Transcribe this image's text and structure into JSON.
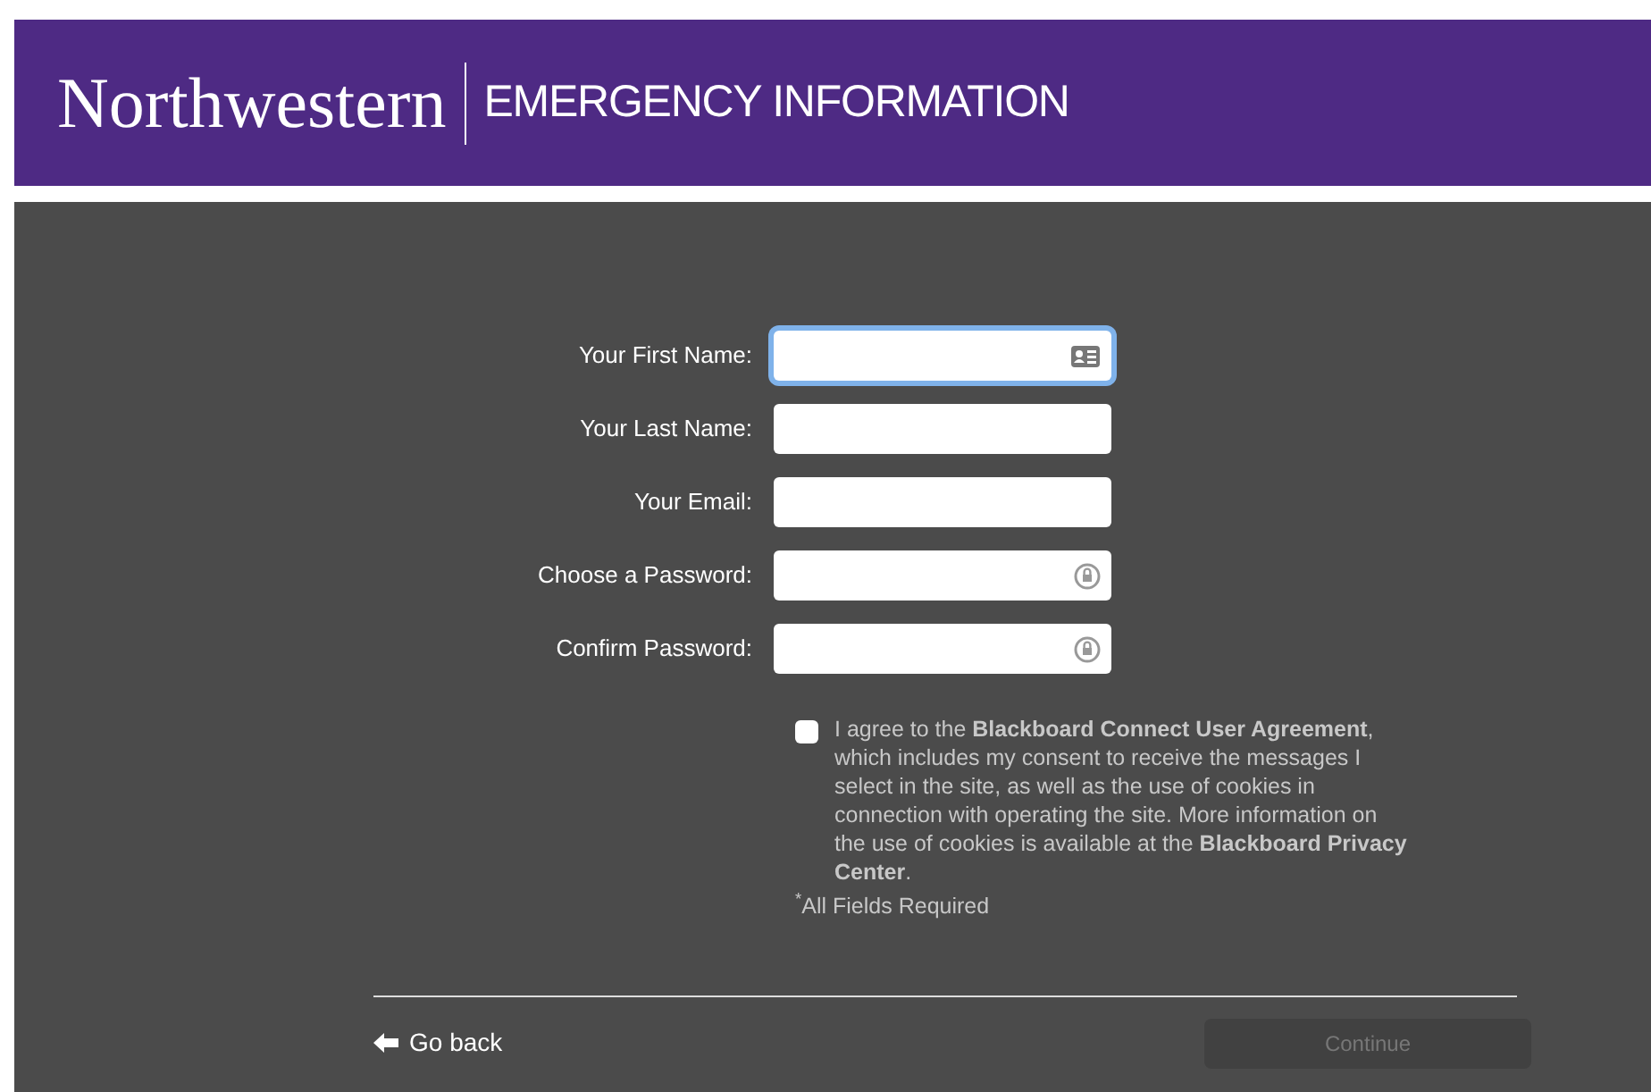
{
  "header": {
    "logo": "Northwestern",
    "title": "EMERGENCY INFORMATION"
  },
  "fields": [
    {
      "label": "Your First Name:",
      "focused": true,
      "kind": "contact"
    },
    {
      "label": "Your Last Name:",
      "focused": false,
      "kind": "text"
    },
    {
      "label": "Your Email:",
      "focused": false,
      "kind": "text"
    },
    {
      "label": "Choose a Password:",
      "focused": false,
      "kind": "password"
    },
    {
      "label": "Confirm Password:",
      "focused": false,
      "kind": "password"
    }
  ],
  "agreement": {
    "checked": false,
    "text": "I agree to the **Blackboard Connect User Agreement**, which includes my consent to receive the messages I select in the site, as well as the use of cookies in connection with operating the site. More information on the use of cookies is available at the **Blackboard Privacy Center**."
  },
  "required_note": "$^{*}$All Fields Required",
  "footer": {
    "back": "Go back",
    "continue": {
      "label": "Continue",
      "disabled": true
    }
  }
}
